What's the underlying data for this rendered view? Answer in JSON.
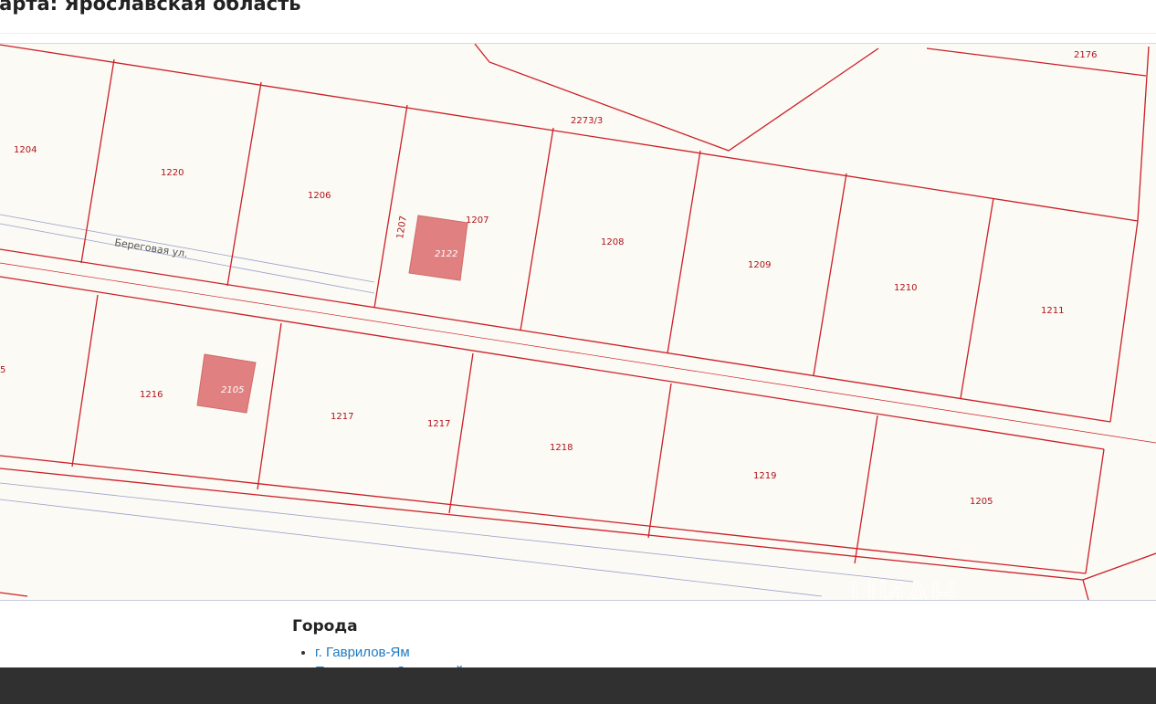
{
  "page": {
    "title": "Карта: Ярославская область"
  },
  "map": {
    "colors": {
      "background": "#fbfaf4",
      "boundary": "#cc1f27",
      "building_fill": "#e08080",
      "road_line": "#9aa0cc",
      "label": "#b0121b"
    },
    "street_label": "Береговая ул.",
    "watermark": "ЦИАН",
    "plot_labels": [
      "2176",
      "2273/3",
      "1204",
      "1220",
      "1206",
      "1207",
      "1207",
      "1208",
      "1209",
      "1210",
      "1211",
      "5",
      "1216",
      "1217",
      "1217",
      "1218",
      "1219",
      "1205"
    ],
    "building_labels": [
      "2122",
      "2105"
    ]
  },
  "cities": {
    "heading": "Города",
    "items": [
      {
        "label": "г. Гаврилов-Ям"
      },
      {
        "label": "Переславль-Залесский"
      }
    ]
  }
}
